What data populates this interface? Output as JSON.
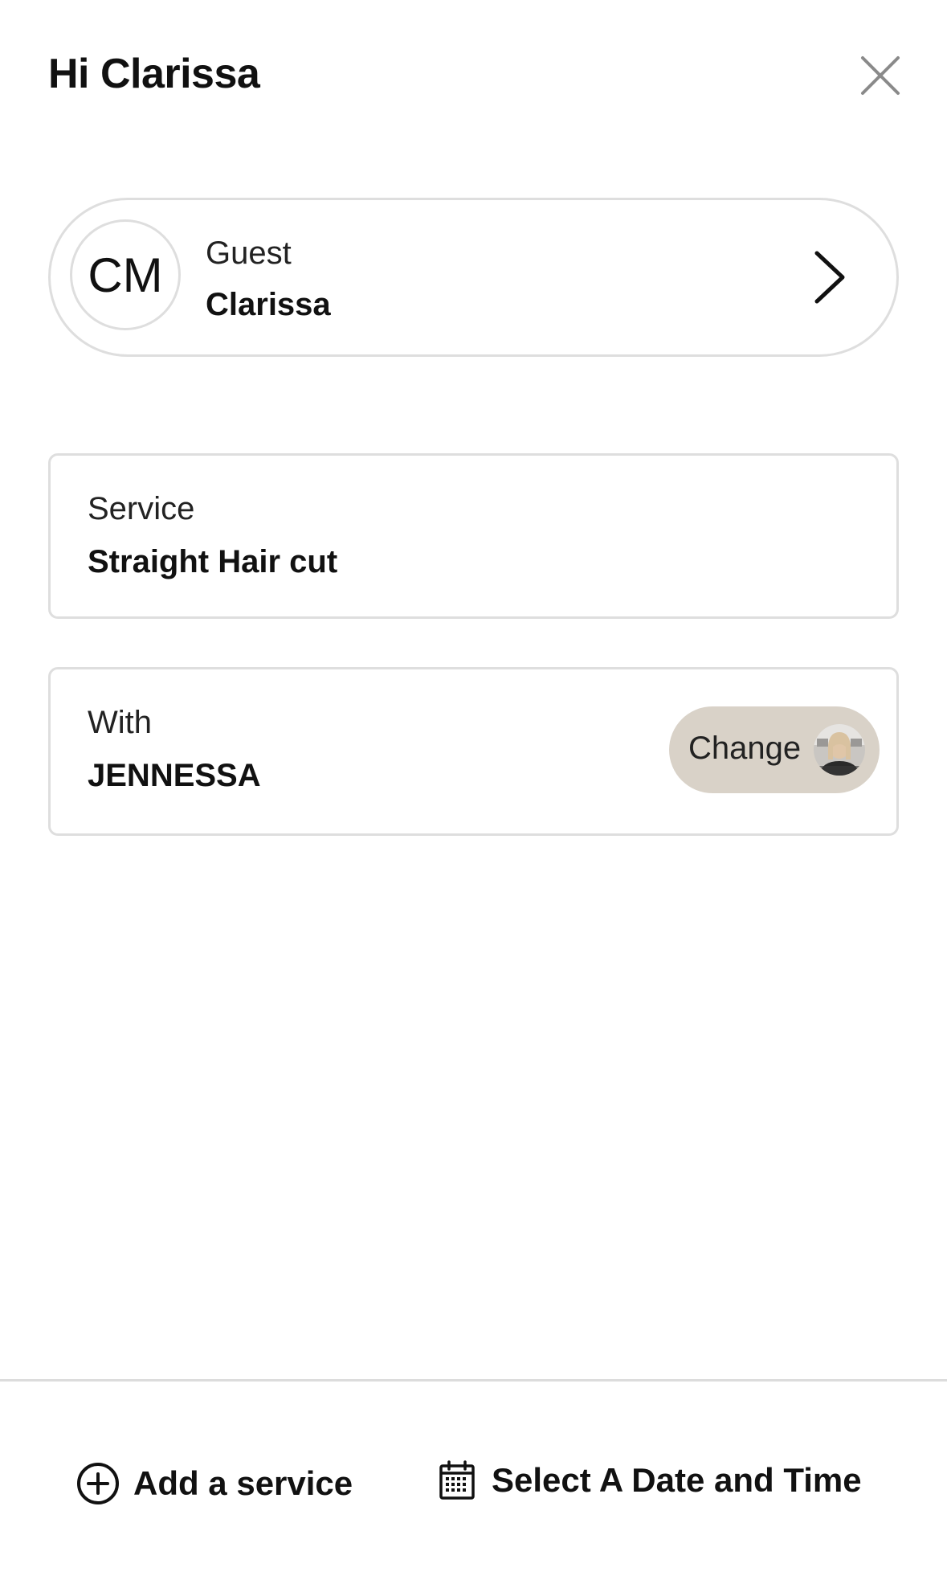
{
  "header": {
    "greeting": "Hi Clarissa",
    "close_icon": "close-icon"
  },
  "guest": {
    "initials": "CM",
    "label": "Guest",
    "name": "Clarissa",
    "chevron_icon": "chevron-right-icon"
  },
  "service": {
    "label": "Service",
    "value": "Straight Hair cut"
  },
  "staff": {
    "label": "With",
    "name": "JENNESSA",
    "change_label": "Change",
    "photo": "staff-avatar-photo"
  },
  "footer": {
    "add_service_label": "Add a service",
    "add_service_icon": "plus-circle-icon",
    "select_date_label": "Select A Date and Time",
    "select_date_icon": "calendar-icon"
  },
  "colors": {
    "border": "#dedede",
    "change_button_bg": "#d9d2c8",
    "text": "#111111",
    "divider": "#dcdcdc"
  }
}
